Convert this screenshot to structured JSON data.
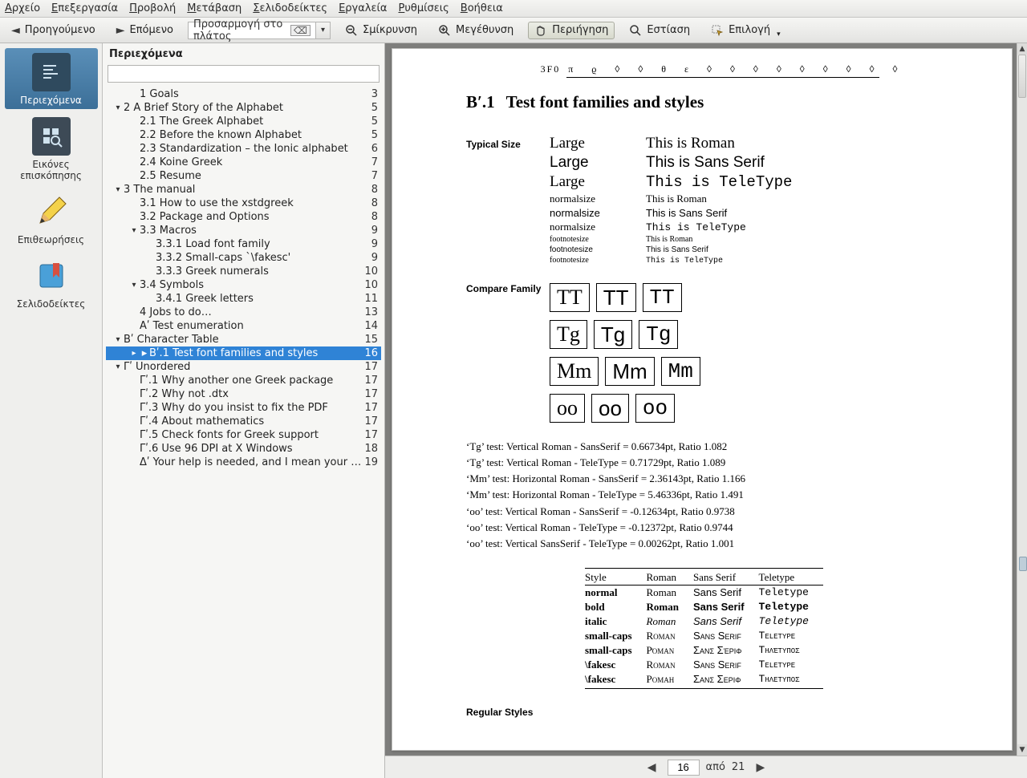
{
  "menubar": [
    "Αρχείο",
    "Επεξεργασία",
    "Προβολή",
    "Μετάβαση",
    "Σελιδοδείκτες",
    "Εργαλεία",
    "Ρυθμίσεις",
    "Βοήθεια"
  ],
  "toolbar": {
    "prev": "Προηγούμενο",
    "next": "Επόμενο",
    "zoom_mode": "Προσαρμογή στο πλάτος",
    "zoom_out": "Σμίκρυνση",
    "zoom_in": "Μεγέθυνση",
    "browse": "Περιήγηση",
    "focus": "Εστίαση",
    "select": "Επιλογή"
  },
  "iconbar": {
    "contents": "Περιεχόμενα",
    "thumbnails": "Εικόνες επισκόπησης",
    "reviews": "Επιθεωρήσεις",
    "bookmarks": "Σελιδοδείκτες"
  },
  "sidepane": {
    "title": "Περιεχόμενα",
    "search_placeholder": ""
  },
  "toc": [
    {
      "d": 1,
      "tw": "",
      "t": "1 Goals",
      "p": 3
    },
    {
      "d": 0,
      "tw": "▾",
      "t": "2 A Brief Story of the Alphabet",
      "p": 5
    },
    {
      "d": 1,
      "tw": "",
      "t": "2.1 The Greek Alphabet",
      "p": 5
    },
    {
      "d": 1,
      "tw": "",
      "t": "2.2 Before the known Alphabet",
      "p": 5
    },
    {
      "d": 1,
      "tw": "",
      "t": "2.3 Standardization – the Ionic alphabet",
      "p": 6
    },
    {
      "d": 1,
      "tw": "",
      "t": "2.4 Koine Greek",
      "p": 7
    },
    {
      "d": 1,
      "tw": "",
      "t": "2.5 Resume",
      "p": 7
    },
    {
      "d": 0,
      "tw": "▾",
      "t": "3 The manual",
      "p": 8
    },
    {
      "d": 1,
      "tw": "",
      "t": "3.1 How to use the xstdgreek",
      "p": 8
    },
    {
      "d": 1,
      "tw": "",
      "t": "3.2 Package and Options",
      "p": 8
    },
    {
      "d": 1,
      "tw": "▾",
      "t": "3.3 Macros",
      "p": 9
    },
    {
      "d": 2,
      "tw": "",
      "t": "3.3.1 Load font family",
      "p": 9
    },
    {
      "d": 2,
      "tw": "",
      "t": "3.3.2 Small-caps `\\fakesc'",
      "p": 9
    },
    {
      "d": 2,
      "tw": "",
      "t": "3.3.3 Greek numerals",
      "p": 10
    },
    {
      "d": 1,
      "tw": "▾",
      "t": "3.4 Symbols",
      "p": 10
    },
    {
      "d": 2,
      "tw": "",
      "t": "3.4.1 Greek letters",
      "p": 11
    },
    {
      "d": 1,
      "tw": "",
      "t": "4 Jobs to do…",
      "p": 13
    },
    {
      "d": 1,
      "tw": "",
      "t": "Aʹ Test enumeration",
      "p": 14
    },
    {
      "d": 0,
      "tw": "▾",
      "t": "Bʹ Character Table",
      "p": 15
    },
    {
      "d": 1,
      "tw": "▸",
      "t": "Bʹ.1 Test font families and styles",
      "p": 16,
      "sel": true
    },
    {
      "d": 0,
      "tw": "▾",
      "t": "Γʹ Unordered",
      "p": 17
    },
    {
      "d": 1,
      "tw": "",
      "t": "Γʹ.1 Why another one Greek package",
      "p": 17
    },
    {
      "d": 1,
      "tw": "",
      "t": "Γʹ.2 Why not .dtx",
      "p": 17
    },
    {
      "d": 1,
      "tw": "",
      "t": "Γʹ.3 Why do you insist to fix the PDF",
      "p": 17
    },
    {
      "d": 1,
      "tw": "",
      "t": "Γʹ.4 About mathematics",
      "p": 17
    },
    {
      "d": 1,
      "tw": "",
      "t": "Γʹ.5 Check fonts for Greek support",
      "p": 17
    },
    {
      "d": 1,
      "tw": "",
      "t": "Γʹ.6 Use 96 DPI at X Windows",
      "p": 18
    },
    {
      "d": 1,
      "tw": "",
      "t": "Δʹ Your help is needed, and I mean your feedback",
      "p": 19
    }
  ],
  "doc": {
    "hexcode": "3F0",
    "charrow": [
      "π",
      "ϱ",
      "◊",
      "◊",
      "θ",
      "ε",
      "◊",
      "◊",
      "◊",
      "◊",
      "◊",
      "◊",
      "◊",
      "◊",
      "◊"
    ],
    "heading_num": "Bʹ.1",
    "heading_text": "Test font families and styles",
    "typical_label": "Typical Size",
    "sizes": [
      {
        "size": "Large",
        "cls": "lg",
        "txt": "This is Roman",
        "fam": ""
      },
      {
        "size": "Large",
        "cls": "lg",
        "txt": "This is Sans Serif",
        "fam": "sans"
      },
      {
        "size": "Large",
        "cls": "lg",
        "txt": "This is TeleType",
        "fam": "mono"
      },
      {
        "size": "normalsize",
        "cls": "nm",
        "txt": "This is Roman",
        "fam": ""
      },
      {
        "size": "normalsize",
        "cls": "nm",
        "txt": "This is Sans Serif",
        "fam": "sans"
      },
      {
        "size": "normalsize",
        "cls": "nm",
        "txt": "This is TeleType",
        "fam": "mono"
      },
      {
        "size": "footnotesize",
        "cls": "fn",
        "txt": "This is Roman",
        "fam": ""
      },
      {
        "size": "footnotesize",
        "cls": "fn",
        "txt": "This is Sans Serif",
        "fam": "sans"
      },
      {
        "size": "footnotesize",
        "cls": "fn",
        "txt": "This is TeleType",
        "fam": "mono"
      }
    ],
    "compare_label": "Compare Family",
    "compare_rows": [
      "TT",
      "Tg",
      "Mm",
      "oo"
    ],
    "tests": [
      "‘Tg’ test: Vertical Roman - SansSerif = 0.66734pt, Ratio 1.082",
      "‘Tg’ test: Vertical Roman - TeleType = 0.71729pt, Ratio 1.089",
      "‘Mm’ test: Horizontal Roman - SansSerif = 2.36143pt, Ratio 1.166",
      "‘Mm’ test: Horizontal Roman - TeleType = 5.46336pt, Ratio 1.491",
      "‘oo’ test: Vertical Roman - SansSerif = -0.12634pt, Ratio 0.9738",
      "‘oo’ test: Vertical Roman - TeleType = -0.12372pt, Ratio 0.9744",
      "‘oo’ test: Vertical SansSerif - TeleType = 0.00262pt, Ratio 1.001"
    ],
    "table_head": [
      "Style",
      "Roman",
      "Sans Serif",
      "Teletype"
    ],
    "table_rows": [
      {
        "s": "normal",
        "r": "Roman",
        "ss": "Sans Serif",
        "tt": "Teletype",
        "cls": ""
      },
      {
        "s": "bold",
        "r": "Roman",
        "ss": "Sans Serif",
        "tt": "Teletype",
        "cls": "b"
      },
      {
        "s": "italic",
        "r": "Roman",
        "ss": "Sans Serif",
        "tt": "Teletype",
        "cls": "i"
      },
      {
        "s": "small-caps",
        "r": "Roman",
        "ss": "Sans Serif",
        "tt": "Teletype",
        "cls": "sc"
      },
      {
        "s": "small-caps",
        "r": "Ρόμαν",
        "ss": "Σανς Σέριφ",
        "tt": "Τηλέτυπος",
        "cls": "sc"
      },
      {
        "s": "\\fakesc",
        "r": "Roman",
        "ss": "Sans Serif",
        "tt": "Teletype",
        "cls": "sc"
      },
      {
        "s": "\\fakesc",
        "r": "Ροман",
        "ss": "Σανς Σεριφ",
        "tt": "Τηλετυπος",
        "cls": "sc"
      }
    ],
    "regular_label": "Regular Styles"
  },
  "pager": {
    "page": "16",
    "of_label": "από",
    "total": "21"
  }
}
